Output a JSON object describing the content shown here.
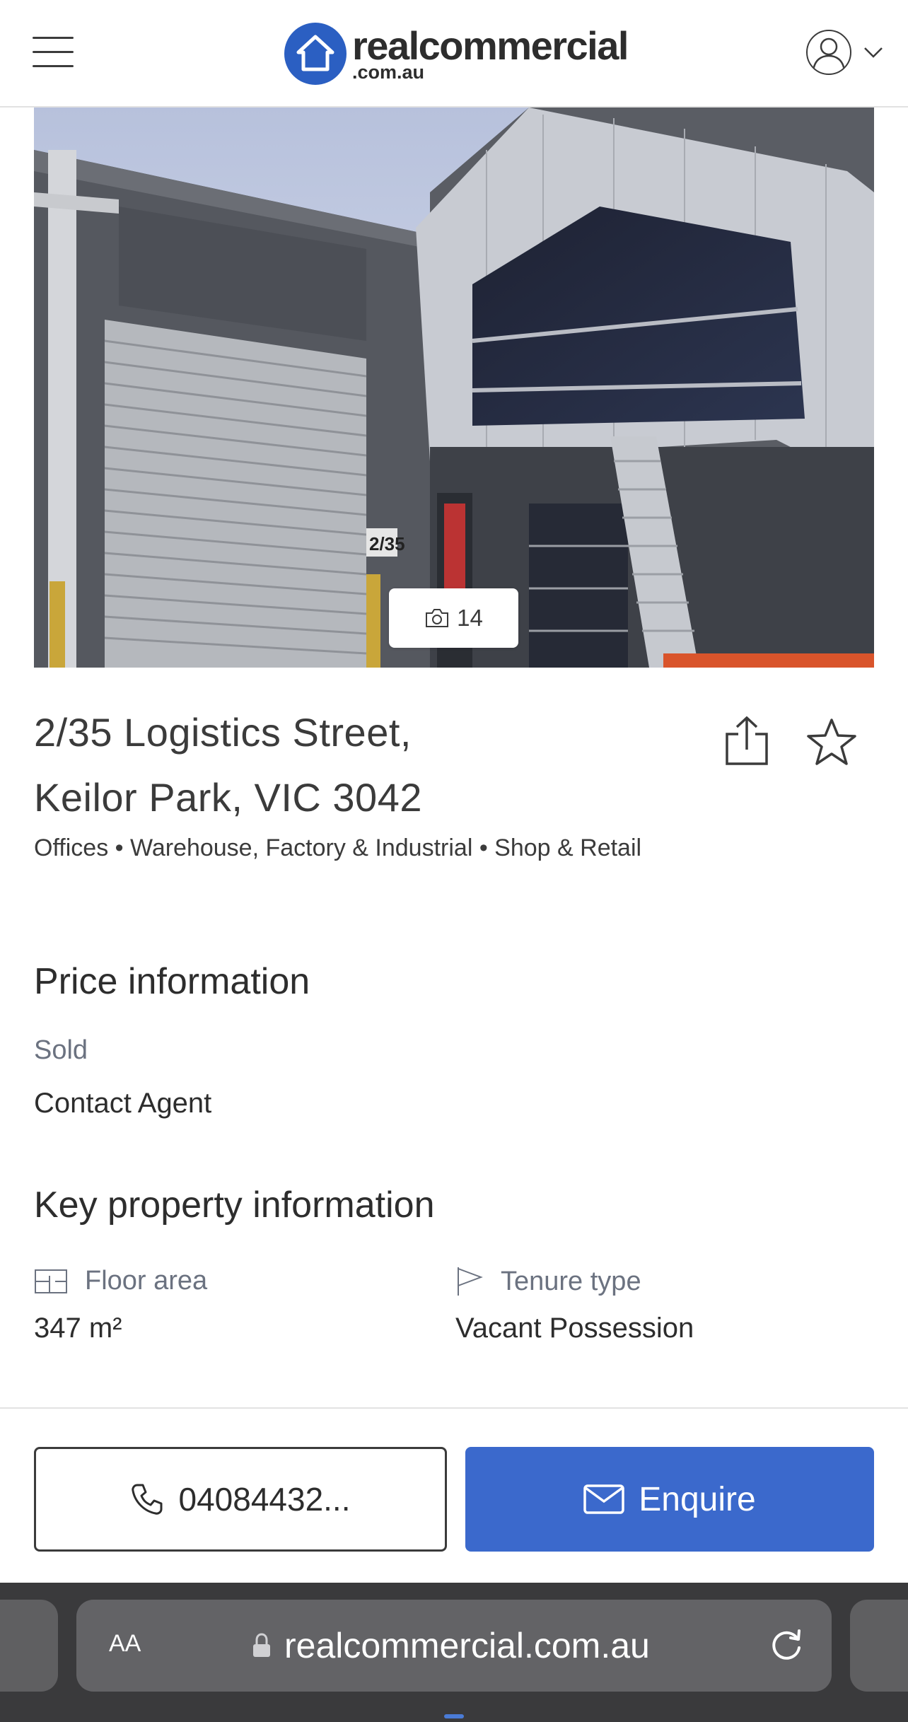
{
  "header": {
    "menu_icon": "hamburger-menu-icon",
    "logo_main": "realcommercial",
    "logo_sub": ".com.au",
    "account_icon": "user-icon",
    "account_chevron": "chevron-down-icon"
  },
  "hero": {
    "photo_count": "14",
    "photo_icon": "camera-icon"
  },
  "listing": {
    "address_line1": "2/35 Logistics Street,",
    "address_line2": "Keilor Park, VIC 3042",
    "property_types": "Offices • Warehouse, Factory & Industrial • Shop & Retail",
    "share_icon": "share-icon",
    "favourite_icon": "star-icon"
  },
  "price": {
    "heading": "Price information",
    "status": "Sold",
    "value": "Contact Agent"
  },
  "key_info": {
    "heading": "Key property information",
    "floor_area_label": "Floor area",
    "floor_area_value": "347 m²",
    "tenure_label": "Tenure type",
    "tenure_value": "Vacant Possession"
  },
  "actions": {
    "call_label": "04084432...",
    "enquire_label": "Enquire"
  },
  "browser": {
    "aa_label": "AA",
    "url": "realcommercial.com.au"
  },
  "colors": {
    "brand_blue": "#2b5fc2",
    "enquire_blue": "#3b69cc"
  }
}
